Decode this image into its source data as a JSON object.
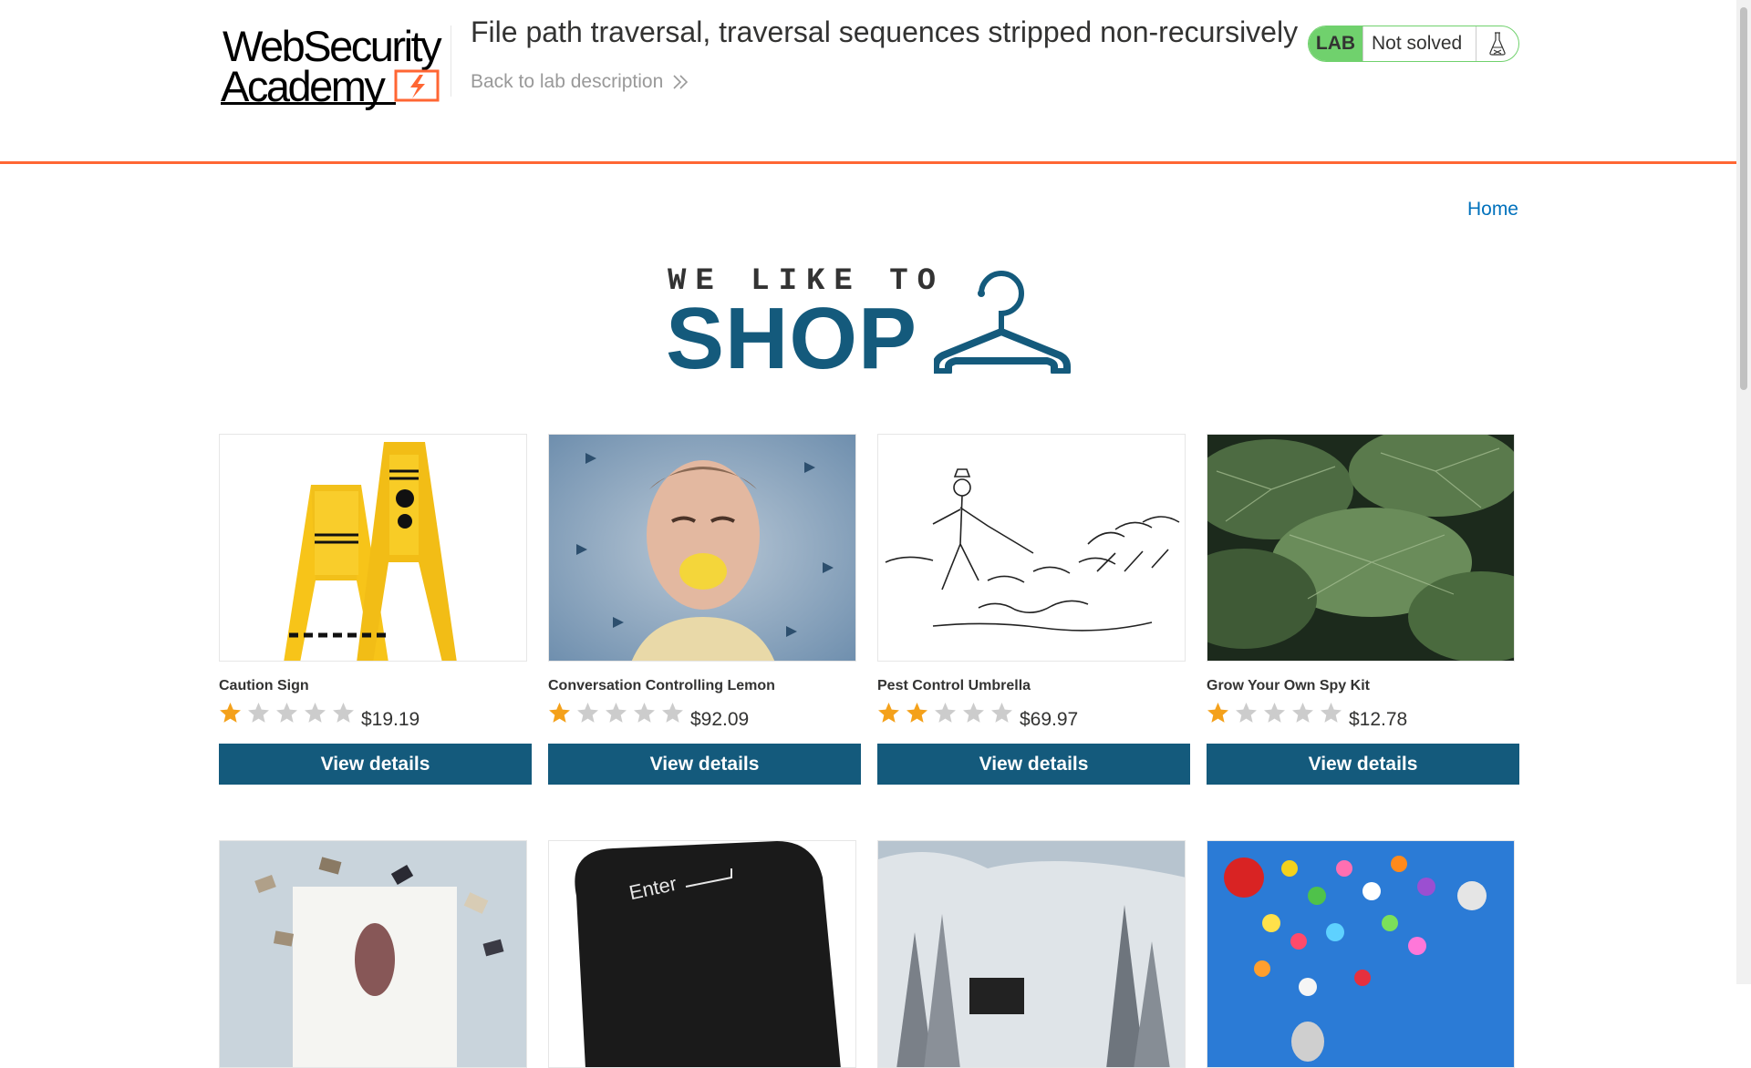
{
  "header": {
    "logo": {
      "line1": "WebSecurity",
      "line2": "Academy"
    },
    "lab_title": "File path traversal, traversal sequences stripped non-recursively",
    "back_link": "Back to lab description",
    "lab_status": {
      "badge": "LAB",
      "status": "Not solved"
    }
  },
  "nav": {
    "home": "Home"
  },
  "banner": {
    "top": "WE LIKE TO",
    "bottom": "SHOP"
  },
  "colors": {
    "accent_orange": "#ff6633",
    "button_blue": "#145a7c",
    "link_blue": "#0071bc",
    "lab_green": "#70d16d",
    "star_gold": "#f4a11b",
    "star_grey": "#cccccc"
  },
  "products": [
    {
      "name": "Caution Sign",
      "rating": 1,
      "price": "$19.19",
      "button": "View details",
      "image": "caution-sign"
    },
    {
      "name": "Conversation Controlling Lemon",
      "rating": 1,
      "price": "$92.09",
      "button": "View details",
      "image": "lemon"
    },
    {
      "name": "Pest Control Umbrella",
      "rating": 2,
      "price": "$69.97",
      "button": "View details",
      "image": "umbrella-sketch"
    },
    {
      "name": "Grow Your Own Spy Kit",
      "rating": 1,
      "price": "$12.78",
      "button": "View details",
      "image": "leaves"
    },
    {
      "image": "floating-books"
    },
    {
      "image": "enter-key"
    },
    {
      "image": "snowy-train"
    },
    {
      "image": "balloons"
    }
  ]
}
